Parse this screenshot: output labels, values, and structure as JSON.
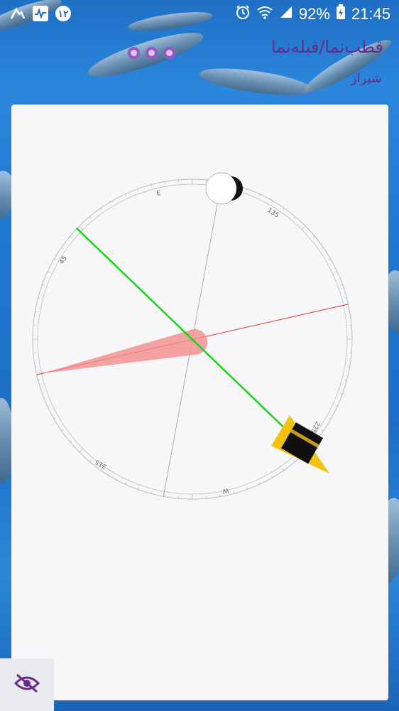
{
  "status_bar": {
    "notifications": [
      {
        "icon": "app-a-icon",
        "label": "A"
      },
      {
        "icon": "activity-icon",
        "label": ""
      },
      {
        "icon": "calendar-badge-icon",
        "label": "۱۲"
      }
    ],
    "icons": [
      "alarm-icon",
      "wifi-icon",
      "signal-icon"
    ],
    "battery_percent": "92%",
    "time": "21:45"
  },
  "header": {
    "title": "قطب‌نما/قبله‌نما",
    "city": "شیراز"
  },
  "compass": {
    "tick_labels": {
      "e": "E",
      "d135": "135",
      "d45": "45",
      "d225": "225",
      "d315": "315",
      "w": "W"
    },
    "moon_icon": "moon-icon",
    "qibla_icon": "kaaba-icon",
    "colors": {
      "qibla_line": "#12d812",
      "needle": "#f28b8b",
      "red_line": "#d33",
      "ring": "#bbbbbb",
      "kaaba_arrow": "#f2c20f"
    }
  },
  "footer": {
    "hide_button_icon": "eye-off-icon"
  }
}
